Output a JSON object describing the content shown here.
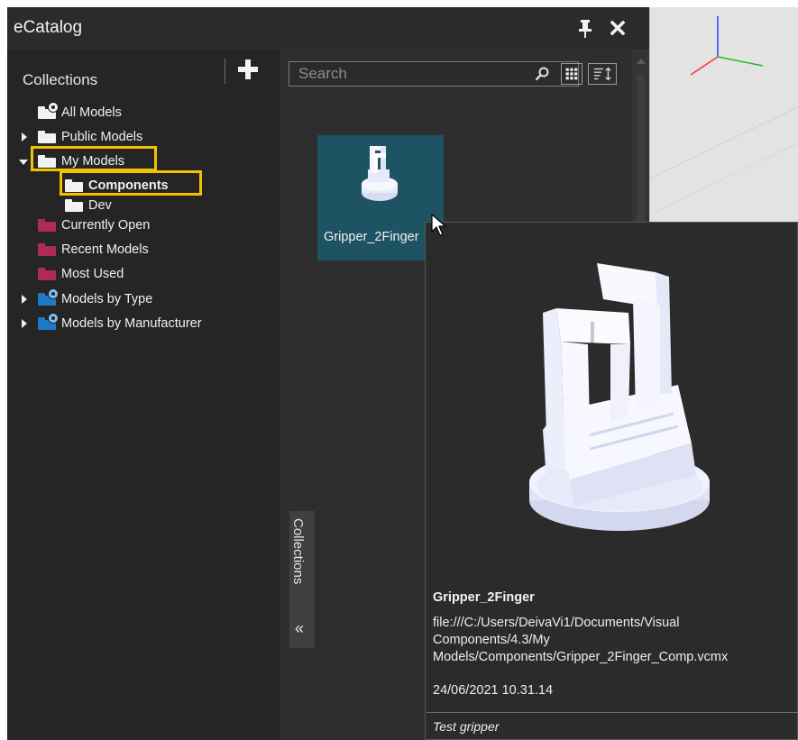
{
  "window": {
    "title": "eCatalog"
  },
  "collections": {
    "header": "Collections",
    "items": [
      {
        "label": "All Models"
      },
      {
        "label": "Public Models"
      },
      {
        "label": "My Models"
      },
      {
        "label": "Components"
      },
      {
        "label": "Dev"
      },
      {
        "label": "Currently Open"
      },
      {
        "label": "Recent Models"
      },
      {
        "label": "Most Used"
      },
      {
        "label": "Models by Type"
      },
      {
        "label": "Models by Manufacturer"
      }
    ]
  },
  "models": {
    "search_placeholder": "Search",
    "tile_label": "Gripper_2Finger",
    "collapse_tab_label": "Collections",
    "collapse_chevron": "«"
  },
  "tooltip": {
    "name": "Gripper_2Finger",
    "path": "file:///C:/Users/DeivaVi1/Documents/Visual Components/4.3/My Models/Components/Gripper_2Finger_Comp.vcmx",
    "date": "24/06/2021 10.31.14",
    "description": "Test gripper"
  },
  "colors": {
    "panel_bg": "#2b2b2b",
    "highlight": "#f2c200",
    "selected_tile": "#1e5363",
    "pink_folder": "#b02a57",
    "blue_folder": "#1e78c8"
  }
}
